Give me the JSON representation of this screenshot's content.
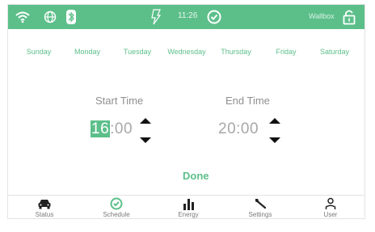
{
  "status_bar": {
    "time": "11:26",
    "device_name": "Wallbox",
    "icons": [
      "wifi-icon",
      "globe-icon",
      "bluetooth-icon",
      "charging-icon",
      "check-circle-icon",
      "lock-icon"
    ]
  },
  "days": [
    "Sunday",
    "Monday",
    "Tuesday",
    "Wednesday",
    "Thursday",
    "Friday",
    "Saturday"
  ],
  "start_time": {
    "label": "Start Time",
    "hours": "16",
    "minutes": ":00"
  },
  "end_time": {
    "label": "End Time",
    "value": "20:00"
  },
  "done_label": "Done",
  "nav": [
    {
      "label": "Status",
      "icon": "car-icon"
    },
    {
      "label": "Schedule",
      "icon": "clock-check-icon"
    },
    {
      "label": "Energy",
      "icon": "bar-chart-icon"
    },
    {
      "label": "Settings",
      "icon": "wrench-icon"
    },
    {
      "label": "User",
      "icon": "user-icon"
    }
  ],
  "colors": {
    "accent": "#5cbf8a",
    "text": "#9a9a9a",
    "arrow": "#111111"
  }
}
